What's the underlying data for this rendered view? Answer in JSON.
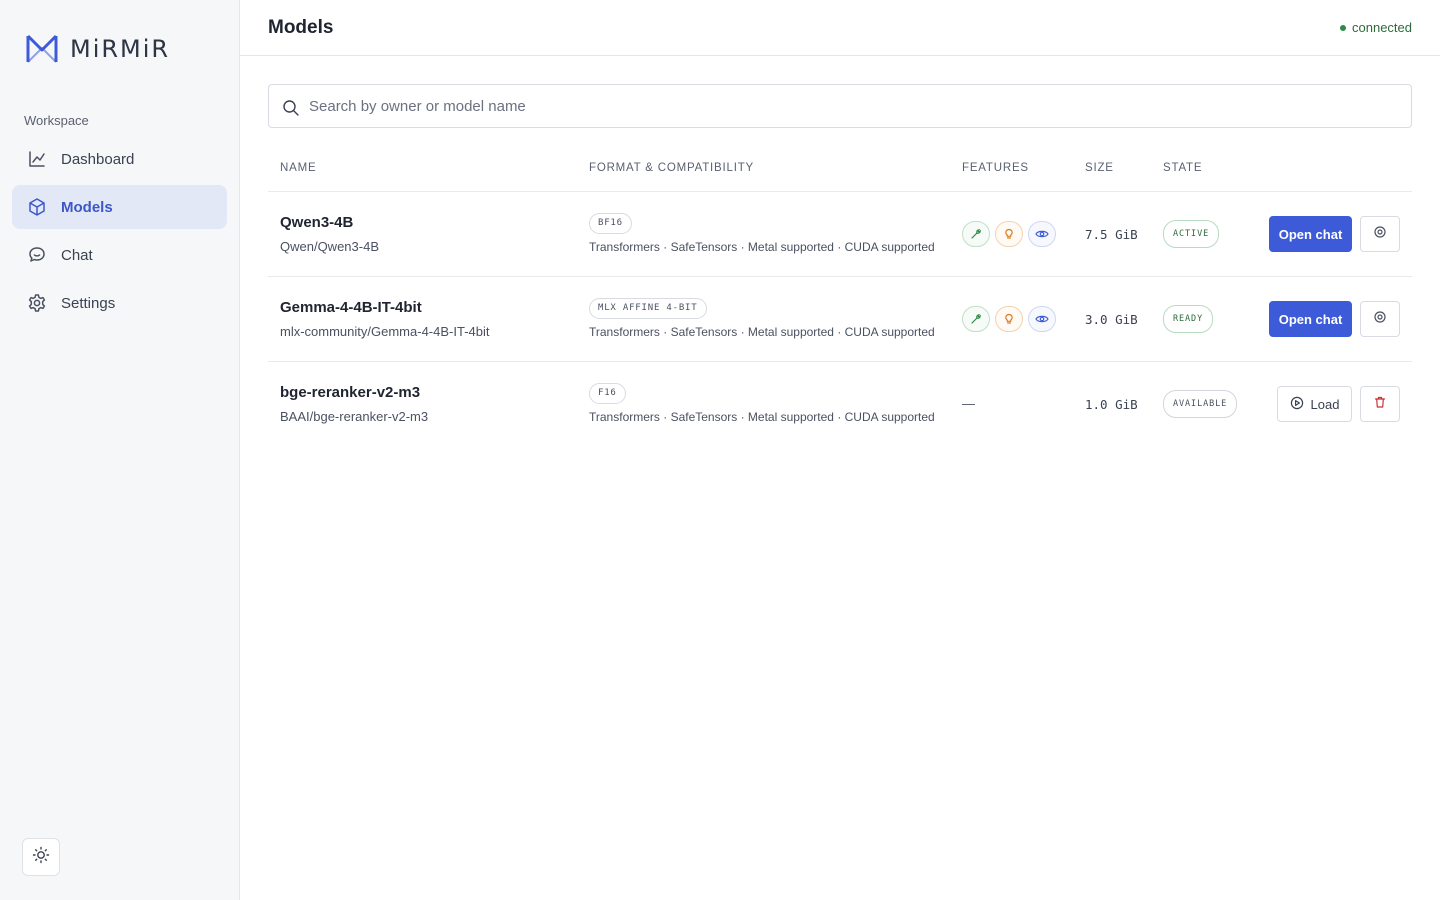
{
  "brand": {
    "name": "MiRMiR",
    "logo_icon": "mirmir-logo-icon",
    "accent": "#3d5bd9"
  },
  "sidebar": {
    "section_label": "Workspace",
    "items": [
      {
        "label": "Dashboard",
        "icon": "chart-line-icon",
        "active": false
      },
      {
        "label": "Models",
        "icon": "cube-icon",
        "active": true
      },
      {
        "label": "Chat",
        "icon": "chat-bubble-icon",
        "active": false
      },
      {
        "label": "Settings",
        "icon": "gear-icon",
        "active": false
      }
    ],
    "theme_toggle_icon": "sun-icon"
  },
  "header": {
    "title": "Models",
    "status": "connected",
    "status_color": "#2e8b45"
  },
  "search": {
    "placeholder": "Search by owner or model name",
    "value": ""
  },
  "table": {
    "columns": {
      "name": "NAME",
      "format": "FORMAT & COMPATIBILITY",
      "features": "FEATURES",
      "size": "SIZE",
      "state": "STATE"
    },
    "rows": [
      {
        "name": "Qwen3-4B",
        "id": "Qwen/Qwen3-4B",
        "format": "BF16",
        "compat": "Transformers · SafeTensors · Metal supported · CUDA supported",
        "features": [
          "tools-icon",
          "reasoning-icon",
          "vision-icon"
        ],
        "size": "7.5 GiB",
        "state": "ACTIVE",
        "primary_action": "Open chat",
        "secondary_action_icon": "target-icon"
      },
      {
        "name": "Gemma-4-4B-IT-4bit",
        "id": "mlx-community/Gemma-4-4B-IT-4bit",
        "format": "MLX AFFINE 4-BIT",
        "compat": "Transformers · SafeTensors · Metal supported · CUDA supported",
        "features": [
          "tools-icon",
          "reasoning-icon",
          "vision-icon"
        ],
        "size": "3.0 GiB",
        "state": "READY",
        "primary_action": "Open chat",
        "secondary_action_icon": "target-icon"
      },
      {
        "name": "bge-reranker-v2-m3",
        "id": "BAAI/bge-reranker-v2-m3",
        "format": "F16",
        "compat": "Transformers · SafeTensors · Metal supported · CUDA supported",
        "features_empty": "—",
        "size": "1.0 GiB",
        "state": "AVAILABLE",
        "primary_action": "Load",
        "secondary_action_icon": "trash-icon"
      }
    ]
  }
}
